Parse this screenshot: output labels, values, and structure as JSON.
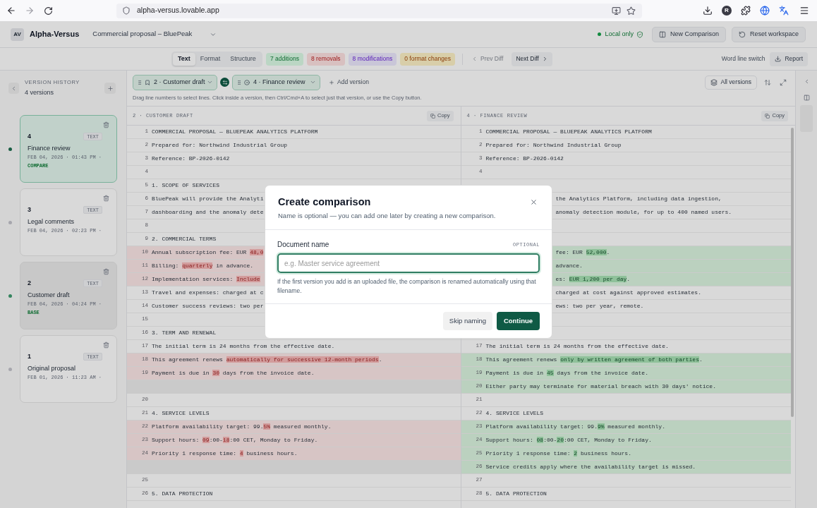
{
  "browser": {
    "url": "alpha-versus.lovable.app",
    "profile": "R"
  },
  "header": {
    "logo": "AV",
    "app_name": "Alpha-Versus",
    "document": "Commercial proposal – BluePeak",
    "status": "Local only",
    "actions": [
      {
        "label": "New Comparison",
        "kind": "new"
      },
      {
        "label": "Reset workspace",
        "kind": "reset"
      }
    ]
  },
  "toolbar": {
    "tabs": [
      {
        "label": "Text",
        "selected": true
      },
      {
        "label": "Format",
        "selected": false
      },
      {
        "label": "Structure",
        "selected": false
      }
    ],
    "badges": [
      {
        "label": "7 additions",
        "kind": "additions"
      },
      {
        "label": "8 removals",
        "kind": "removals"
      },
      {
        "label": "8 modifications",
        "kind": "modifications"
      },
      {
        "label": "0 format changes",
        "kind": "format"
      }
    ],
    "nav": [
      {
        "label": "Prev Diff",
        "kind": "prev",
        "disabled": true
      },
      {
        "label": "Next Diff",
        "kind": "next",
        "disabled": false
      }
    ],
    "switch_label": "Word line switch",
    "report": "Report"
  },
  "sidebar": {
    "title": "VERSION HISTORY",
    "count": "4 versions",
    "versions": [
      {
        "number": "4",
        "type": "TEXT",
        "name": "Finance review",
        "date": "FEB 04, 2026 · 01:43 PM ·",
        "tag": "COMPARE",
        "kind": "compare"
      },
      {
        "number": "3",
        "type": "TEXT",
        "name": "Legal comments",
        "date": "FEB 04, 2026 · 02:23 PM ·",
        "kind": "plain"
      },
      {
        "number": "2",
        "type": "TEXT",
        "name": "Customer draft",
        "date": "FEB 04, 2026 · 04:24 PM ·",
        "tag": "BASE",
        "kind": "base"
      },
      {
        "number": "1",
        "type": "TEXT",
        "name": "Original proposal",
        "date": "FEB 01, 2026 · 11:23 AM ·",
        "kind": "plain"
      }
    ]
  },
  "compare_bar": {
    "slots": [
      {
        "label": "2 · Customer draft",
        "kind": "base"
      },
      {
        "label": "4 · Finance review",
        "kind": "compare"
      }
    ],
    "add": "Add version",
    "view": "All versions"
  },
  "hint": "Drag line numbers to select lines. Click inside a version, then Ctrl/Cmd+A to select just that version, or use the Copy button.",
  "panes": [
    {
      "title": "2 · CUSTOMER DRAFT",
      "copy": "Copy",
      "rows": [
        {
          "n": "1",
          "kind": "same",
          "text": "COMMERCIAL PROPOSAL — BLUEPEAK ANALYTICS PLATFORM"
        },
        {
          "n": "2",
          "kind": "same",
          "text": "Prepared for: Northwind Industrial Group"
        },
        {
          "n": "3",
          "kind": "same",
          "text": "Reference: BP-2026-0142"
        },
        {
          "n": "4",
          "kind": "same"
        },
        {
          "n": "5",
          "kind": "same",
          "text": "1. SCOPE OF SERVICES"
        },
        {
          "n": "6",
          "kind": "same",
          "text": "BluePeak will provide the Analyti"
        },
        {
          "n": "7",
          "kind": "same",
          "text": "dashboarding and the anomaly dete"
        },
        {
          "n": "8",
          "kind": "same"
        },
        {
          "n": "9",
          "kind": "same",
          "text": "2. COMMERCIAL TERMS"
        },
        {
          "n": "10",
          "kind": "removed",
          "segments": [
            {
              "text": "Annual subscription fee: EUR ",
              "changed": false
            },
            {
              "text": "48,0",
              "changed": true
            }
          ]
        },
        {
          "n": "11",
          "kind": "removed",
          "segments": [
            {
              "text": "Billing: ",
              "changed": false
            },
            {
              "text": "quarterly",
              "changed": true
            },
            {
              "text": " in advance.",
              "changed": false
            }
          ]
        },
        {
          "n": "12",
          "kind": "removed",
          "segments": [
            {
              "text": "Implementation services: ",
              "changed": false
            },
            {
              "text": "Include",
              "changed": true
            }
          ]
        },
        {
          "n": "13",
          "kind": "same",
          "text": "Travel and expenses: charged at c"
        },
        {
          "n": "14",
          "kind": "same",
          "text": "Customer success reviews: two per"
        },
        {
          "n": "15",
          "kind": "same"
        },
        {
          "n": "16",
          "kind": "same",
          "text": "3. TERM AND RENEWAL"
        },
        {
          "n": "17",
          "kind": "same",
          "text": "The initial term is 24 months from the effective date."
        },
        {
          "n": "18",
          "kind": "removed",
          "segments": [
            {
              "text": "This agreement renews ",
              "changed": false
            },
            {
              "text": "automatically for successive 12-month periods",
              "changed": true
            },
            {
              "text": ".",
              "changed": false
            }
          ]
        },
        {
          "n": "19",
          "kind": "removed",
          "segments": [
            {
              "text": "Payment is due in ",
              "changed": false
            },
            {
              "text": "30",
              "changed": true
            },
            {
              "text": " days from the invoice date.",
              "changed": false
            }
          ]
        },
        {
          "kind": "spacer"
        },
        {
          "n": "20",
          "kind": "same"
        },
        {
          "n": "21",
          "kind": "same",
          "text": "4. SERVICE LEVELS"
        },
        {
          "n": "22",
          "kind": "removed",
          "segments": [
            {
              "text": "Platform availability target: 99.",
              "changed": false
            },
            {
              "text": "5%",
              "changed": true
            },
            {
              "text": " measured monthly.",
              "changed": false
            }
          ]
        },
        {
          "n": "23",
          "kind": "removed",
          "segments": [
            {
              "text": "Support hours: ",
              "changed": false
            },
            {
              "text": "09",
              "changed": true
            },
            {
              "text": ":00-",
              "changed": false
            },
            {
              "text": "18",
              "changed": true
            },
            {
              "text": ":00 CET, Monday to Friday.",
              "changed": false
            }
          ]
        },
        {
          "n": "24",
          "kind": "removed",
          "segments": [
            {
              "text": "Priority 1 response time: ",
              "changed": false
            },
            {
              "text": "4",
              "changed": true
            },
            {
              "text": " business hours.",
              "changed": false
            }
          ]
        },
        {
          "kind": "spacer"
        },
        {
          "n": "25",
          "kind": "same"
        },
        {
          "n": "26",
          "kind": "same",
          "text": "5. DATA PROTECTION"
        }
      ]
    },
    {
      "title": "4 · FINANCE REVIEW",
      "copy": "Copy",
      "rows": [
        {
          "n": "1",
          "kind": "same",
          "text": "COMMERCIAL PROPOSAL — BLUEPEAK ANALYTICS PLATFORM"
        },
        {
          "n": "2",
          "kind": "same",
          "text": "Prepared for: Northwind Industrial Group"
        },
        {
          "n": "3",
          "kind": "same",
          "text": "Reference: BP-2026-0142"
        },
        {
          "n": "4",
          "kind": "same"
        },
        {
          "kind": "same"
        },
        {
          "kind": "same",
          "covered": true,
          "text": "the Analytics Platform, including data ingestion,"
        },
        {
          "kind": "same",
          "covered": true,
          "text": "anomaly detection module, for up to 400 named users."
        },
        {
          "kind": "same"
        },
        {
          "kind": "same"
        },
        {
          "kind": "added",
          "covered": true,
          "segments": [
            {
              "text": "fee: EUR ",
              "changed": false
            },
            {
              "text": "52,000",
              "changed": true
            },
            {
              "text": ".",
              "changed": false
            }
          ]
        },
        {
          "kind": "added",
          "covered": true,
          "text": "advance."
        },
        {
          "kind": "added",
          "covered": true,
          "segments": [
            {
              "text": "es: ",
              "changed": false
            },
            {
              "text": "EUR 1,200 per day",
              "changed": true
            },
            {
              "text": ".",
              "changed": false
            }
          ]
        },
        {
          "kind": "same",
          "covered": true,
          "text": "charged at cost against approved estimates."
        },
        {
          "kind": "same",
          "covered": true,
          "text": "ews: two per year, remote."
        },
        {
          "kind": "same"
        },
        {
          "kind": "same"
        },
        {
          "n": "17",
          "kind": "same",
          "text": "The initial term is 24 months from the effective date."
        },
        {
          "n": "18",
          "kind": "added",
          "segments": [
            {
              "text": "This agreement renews ",
              "changed": false
            },
            {
              "text": "only by written agreement of both parties",
              "changed": true
            },
            {
              "text": ".",
              "changed": false
            }
          ]
        },
        {
          "n": "19",
          "kind": "added",
          "segments": [
            {
              "text": "Payment is due in ",
              "changed": false
            },
            {
              "text": "45",
              "changed": true
            },
            {
              "text": " days from the invoice date.",
              "changed": false
            }
          ]
        },
        {
          "n": "20",
          "kind": "added",
          "text": "Either party may terminate for material breach with 30 days' notice."
        },
        {
          "n": "21",
          "kind": "same"
        },
        {
          "n": "22",
          "kind": "same",
          "text": "4. SERVICE LEVELS"
        },
        {
          "n": "23",
          "kind": "added",
          "segments": [
            {
              "text": "Platform availability target: 99.",
              "changed": false
            },
            {
              "text": "9%",
              "changed": true
            },
            {
              "text": " measured monthly.",
              "changed": false
            }
          ]
        },
        {
          "n": "24",
          "kind": "added",
          "segments": [
            {
              "text": "Support hours: ",
              "changed": false
            },
            {
              "text": "08",
              "changed": true
            },
            {
              "text": ":00-",
              "changed": false
            },
            {
              "text": "20",
              "changed": true
            },
            {
              "text": ":00 CET, Monday to Friday.",
              "changed": false
            }
          ]
        },
        {
          "n": "25",
          "kind": "added",
          "segments": [
            {
              "text": "Priority 1 response time: ",
              "changed": false
            },
            {
              "text": "2",
              "changed": true
            },
            {
              "text": " business hours.",
              "changed": false
            }
          ]
        },
        {
          "n": "26",
          "kind": "added",
          "text": "Service credits apply where the availability target is missed."
        },
        {
          "n": "27",
          "kind": "same"
        },
        {
          "n": "28",
          "kind": "same",
          "text": "5. DATA PROTECTION"
        }
      ]
    }
  ],
  "dialog": {
    "title": "Create comparison",
    "subtitle": "Name is optional — you can add one later by creating a new comparison.",
    "field": {
      "label": "Document name",
      "tag": "OPTIONAL",
      "placeholder": "e.g. Master service agreement",
      "focused": true,
      "help": "If the first version you add is an uploaded file, the comparison is renamed automatically using that filename."
    },
    "buttons": [
      {
        "label": "Skip naming",
        "kind": "secondary"
      },
      {
        "label": "Continue",
        "kind": "primary"
      }
    ]
  }
}
